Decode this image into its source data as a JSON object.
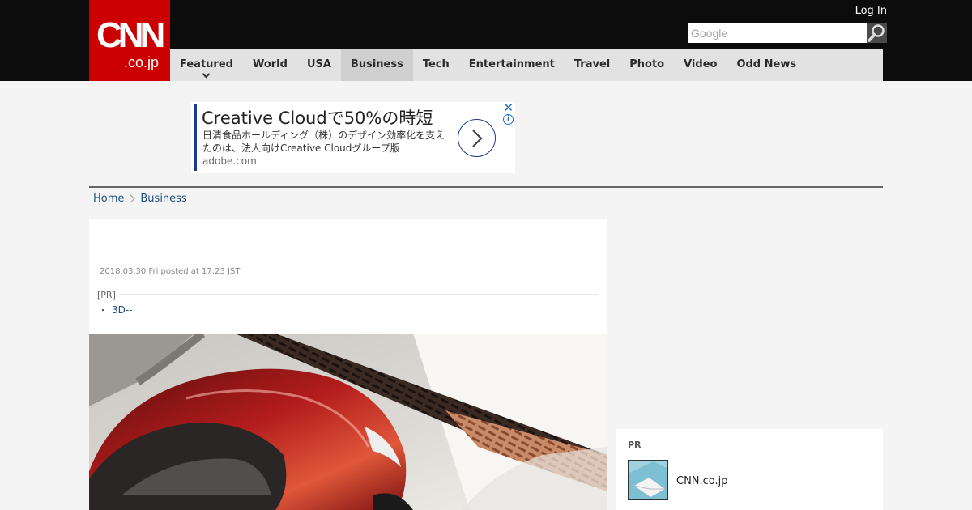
{
  "header": {
    "logo_main": "CNN",
    "logo_sub": ".co.jp",
    "login_label": "Log In",
    "search_placeholder": "Google"
  },
  "nav": {
    "items": [
      {
        "label": "Featured"
      },
      {
        "label": "World"
      },
      {
        "label": "USA"
      },
      {
        "label": "Business"
      },
      {
        "label": "Tech"
      },
      {
        "label": "Entertainment"
      },
      {
        "label": "Travel"
      },
      {
        "label": "Photo"
      },
      {
        "label": "Video"
      },
      {
        "label": "Odd News"
      }
    ],
    "active": "Business"
  },
  "ad": {
    "title": "Creative Cloudで50%の時短",
    "description": "日清食品ホールディング（株）のデザイン効率化を支えたのは、法人向けCreative Cloudグループ版",
    "url": "adobe.com",
    "close_glyph": "✕",
    "info_glyph": "i"
  },
  "breadcrumb": {
    "home": "Home",
    "section": "Business"
  },
  "article": {
    "date": "2018.03.30 Fri posted at 17:23 JST",
    "pr_label": "[PR]",
    "pr_bullet": "・",
    "pr_link": "3D--"
  },
  "sidebar_pr": {
    "label": "PR",
    "title": "CNN.co.jp"
  },
  "colors": {
    "brand_red": "#cc0000",
    "topbar": "#0c0c0c",
    "nav_bg": "#e2e2e2",
    "link": "#1f4f80"
  },
  "icons": {
    "search": "search-icon",
    "chevron": "chevron-right-icon",
    "caret": "chevron-down-icon"
  }
}
